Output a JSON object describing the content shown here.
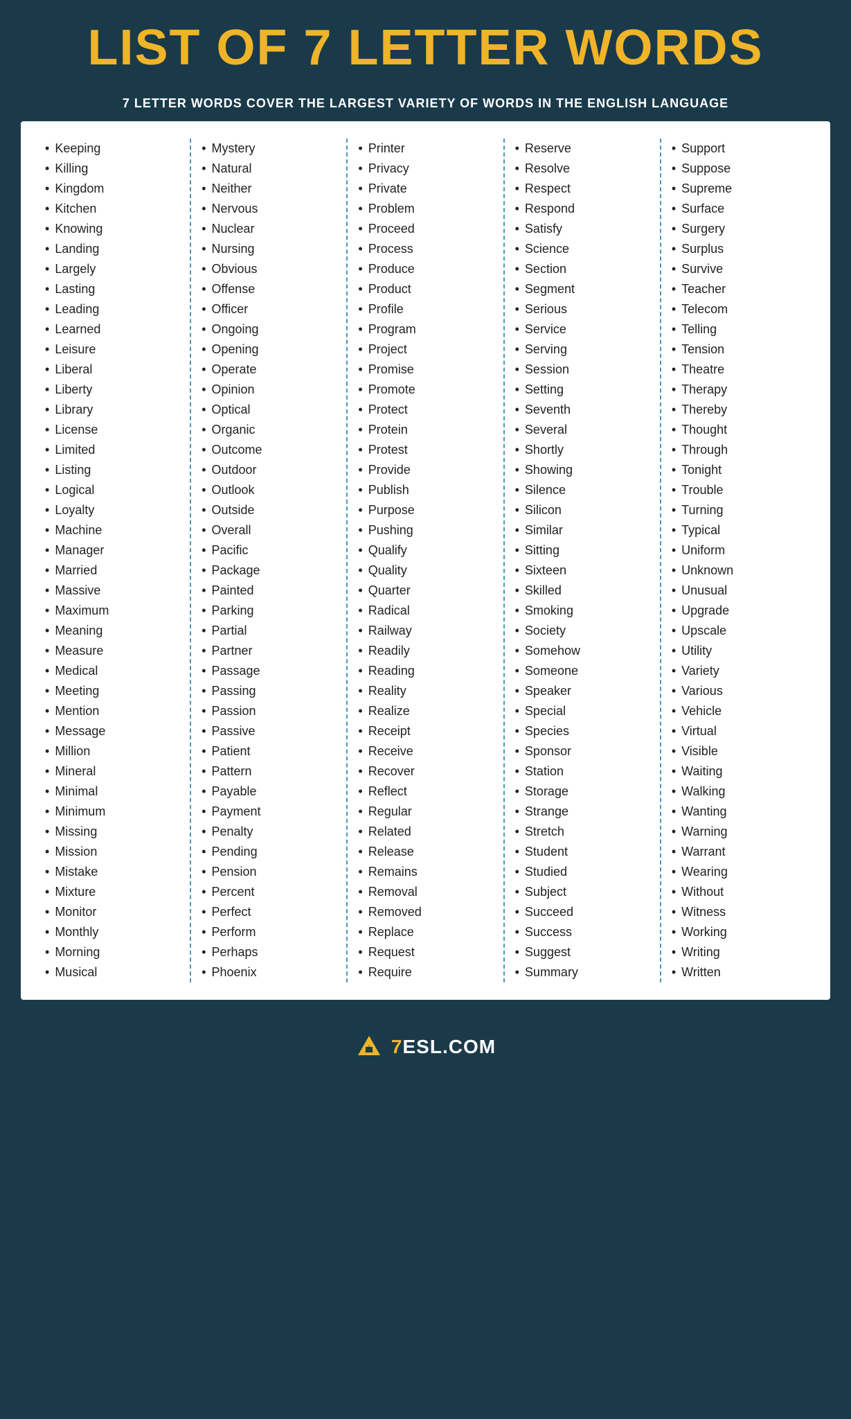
{
  "header": {
    "title": "LIST OF 7 LETTER WORDS",
    "subtitle": "7 LETTER WORDS COVER THE LARGEST VARIETY OF WORDS IN THE ENGLISH LANGUAGE"
  },
  "footer": {
    "logo_text": "7ESL.COM"
  },
  "columns": [
    {
      "words": [
        "Keeping",
        "Killing",
        "Kingdom",
        "Kitchen",
        "Knowing",
        "Landing",
        "Largely",
        "Lasting",
        "Leading",
        "Learned",
        "Leisure",
        "Liberal",
        "Liberty",
        "Library",
        "License",
        "Limited",
        "Listing",
        "Logical",
        "Loyalty",
        "Machine",
        "Manager",
        "Married",
        "Massive",
        "Maximum",
        "Meaning",
        "Measure",
        "Medical",
        "Meeting",
        "Mention",
        "Message",
        "Million",
        "Mineral",
        "Minimal",
        "Minimum",
        "Missing",
        "Mission",
        "Mistake",
        "Mixture",
        "Monitor",
        "Monthly",
        "Morning",
        "Musical"
      ]
    },
    {
      "words": [
        "Mystery",
        "Natural",
        "Neither",
        "Nervous",
        "Nuclear",
        "Nursing",
        "Obvious",
        "Offense",
        "Officer",
        "Ongoing",
        "Opening",
        "Operate",
        "Opinion",
        "Optical",
        "Organic",
        "Outcome",
        "Outdoor",
        "Outlook",
        "Outside",
        "Overall",
        "Pacific",
        "Package",
        "Painted",
        "Parking",
        "Partial",
        "Partner",
        "Passage",
        "Passing",
        "Passion",
        "Passive",
        "Patient",
        "Pattern",
        "Payable",
        "Payment",
        "Penalty",
        "Pending",
        "Pension",
        "Percent",
        "Perfect",
        "Perform",
        "Perhaps",
        "Phoenix"
      ]
    },
    {
      "words": [
        "Printer",
        "Privacy",
        "Private",
        "Problem",
        "Proceed",
        "Process",
        "Produce",
        "Product",
        "Profile",
        "Program",
        "Project",
        "Promise",
        "Promote",
        "Protect",
        "Protein",
        "Protest",
        "Provide",
        "Publish",
        "Purpose",
        "Pushing",
        "Qualify",
        "Quality",
        "Quarter",
        "Radical",
        "Railway",
        "Readily",
        "Reading",
        "Reality",
        "Realize",
        "Receipt",
        "Receive",
        "Recover",
        "Reflect",
        "Regular",
        "Related",
        "Release",
        "Remains",
        "Removal",
        "Removed",
        "Replace",
        "Request",
        "Require"
      ]
    },
    {
      "words": [
        "Reserve",
        "Resolve",
        "Respect",
        "Respond",
        "Satisfy",
        "Science",
        "Section",
        "Segment",
        "Serious",
        "Service",
        "Serving",
        "Session",
        "Setting",
        "Seventh",
        "Several",
        "Shortly",
        "Showing",
        "Silence",
        "Silicon",
        "Similar",
        "Sitting",
        "Sixteen",
        "Skilled",
        "Smoking",
        "Society",
        "Somehow",
        "Someone",
        "Speaker",
        "Special",
        "Species",
        "Sponsor",
        "Station",
        "Storage",
        "Strange",
        "Stretch",
        "Student",
        "Studied",
        "Subject",
        "Succeed",
        "Success",
        "Suggest",
        "Summary"
      ]
    },
    {
      "words": [
        "Support",
        "Suppose",
        "Supreme",
        "Surface",
        "Surgery",
        "Surplus",
        "Survive",
        "Teacher",
        "Telecom",
        "Telling",
        "Tension",
        "Theatre",
        "Therapy",
        "Thereby",
        "Thought",
        "Through",
        "Tonight",
        "Trouble",
        "Turning",
        "Typical",
        "Uniform",
        "Unknown",
        "Unusual",
        "Upgrade",
        "Upscale",
        "Utility",
        "Variety",
        "Various",
        "Vehicle",
        "Virtual",
        "Visible",
        "Waiting",
        "Walking",
        "Wanting",
        "Warning",
        "Warrant",
        "Wearing",
        "Without",
        "Witness",
        "Working",
        "Writing",
        "Written"
      ]
    }
  ]
}
